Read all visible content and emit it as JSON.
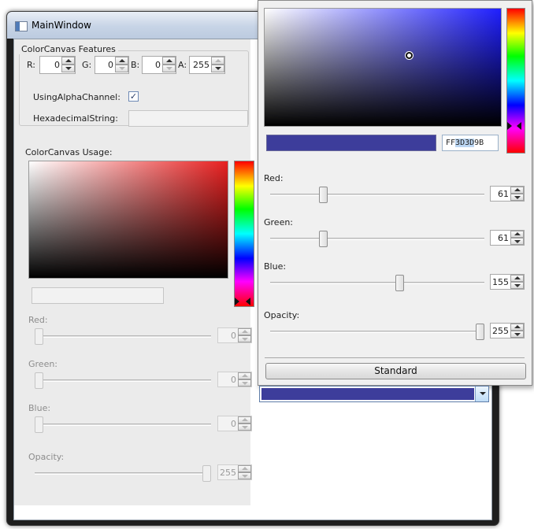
{
  "window": {
    "title": "MainWindow"
  },
  "features": {
    "group_title": "ColorCanvas Features",
    "r_label": "R:",
    "r_value": "0",
    "g_label": "G:",
    "g_value": "0",
    "b_label": "B:",
    "b_value": "0",
    "a_label": "A:",
    "a_value": "255",
    "using_alpha_label": "UsingAlphaChannel:",
    "using_alpha_checked": "✓",
    "hex_label": "HexadecimalString:",
    "hex_value": ""
  },
  "usage": {
    "title": "ColorCanvas Usage:",
    "sv_hue_color": "#e82020",
    "hue_position": 1.0,
    "hex_value": "",
    "sliders": [
      {
        "label": "Red:",
        "value": "0",
        "fraction": 0.0
      },
      {
        "label": "Green:",
        "value": "0",
        "fraction": 0.0
      },
      {
        "label": "Blue:",
        "value": "0",
        "fraction": 0.0
      },
      {
        "label": "Opacity:",
        "value": "255",
        "fraction": 1.0
      }
    ]
  },
  "popup": {
    "selected_color": "#3D3D9B",
    "hex_prefix": "FF",
    "hex_selected": "3D3D",
    "hex_suffix": "9B",
    "hue_position": 0.83,
    "sliders": [
      {
        "label": "Red:",
        "value": "61",
        "fraction": 0.239
      },
      {
        "label": "Green:",
        "value": "61",
        "fraction": 0.239
      },
      {
        "label": "Blue:",
        "value": "155",
        "fraction": 0.608
      },
      {
        "label": "Opacity:",
        "value": "255",
        "fraction": 1.0
      }
    ],
    "standard_button": "Standard"
  },
  "combo": {
    "color": "#3D3D9B"
  }
}
